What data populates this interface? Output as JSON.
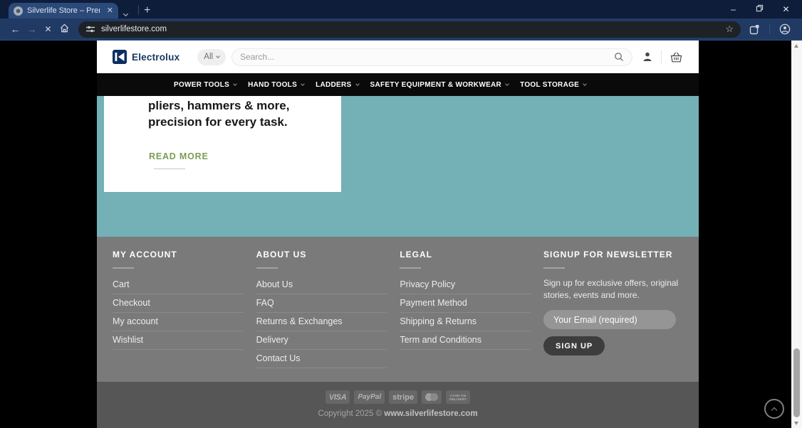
{
  "browser": {
    "tab_title": "Silverlife Store – Premium Tools",
    "url": "silverlifestore.com"
  },
  "header": {
    "brand": "Electrolux",
    "category_selector": "All",
    "search_placeholder": "Search..."
  },
  "nav": {
    "items": [
      "POWER TOOLS",
      "HAND TOOLS",
      "LADDERS",
      "SAFETY EQUIPMENT & WORKWEAR",
      "TOOL STORAGE"
    ]
  },
  "hero": {
    "heading_line1": "pliers, hammers & more,",
    "heading_line2": "precision for every task.",
    "cta": "READ MORE"
  },
  "footer": {
    "columns": [
      {
        "title": "MY ACCOUNT",
        "links": [
          "Cart",
          "Checkout",
          "My account",
          "Wishlist"
        ]
      },
      {
        "title": "ABOUT US",
        "links": [
          "About Us",
          "FAQ",
          "Returns & Exchanges",
          "Delivery",
          "Contact Us"
        ]
      },
      {
        "title": "LEGAL",
        "links": [
          "Privacy Policy",
          "Payment Method",
          "Shipping & Returns",
          "Term and Conditions"
        ]
      }
    ],
    "newsletter": {
      "title": "SIGNUP FOR NEWSLETTER",
      "text": "Sign up for exclusive offers, original stories, events and more.",
      "email_placeholder": "Your Email (required)",
      "submit_label": "SIGN UP"
    }
  },
  "bottom": {
    "payments": [
      {
        "icon": "visa-icon",
        "label": "VISA"
      },
      {
        "icon": "paypal-icon",
        "label": "PayPal"
      },
      {
        "icon": "stripe-icon",
        "label": "stripe"
      },
      {
        "icon": "mastercard-icon",
        "label": ""
      },
      {
        "icon": "cash-on-delivery-icon",
        "label": "CASH ON DELIVERY"
      }
    ],
    "copyright_prefix": "Copyright 2025 © ",
    "copyright_domain": "www.silverlifestore.com"
  },
  "colors": {
    "teal_background": "#73b1b6",
    "footer_gray": "#7a7a7a",
    "bottom_bar_gray": "#565656",
    "accent_green": "#7c9c55",
    "brand_navy": "#0b2e5f",
    "nav_black": "#0a0a0a"
  }
}
